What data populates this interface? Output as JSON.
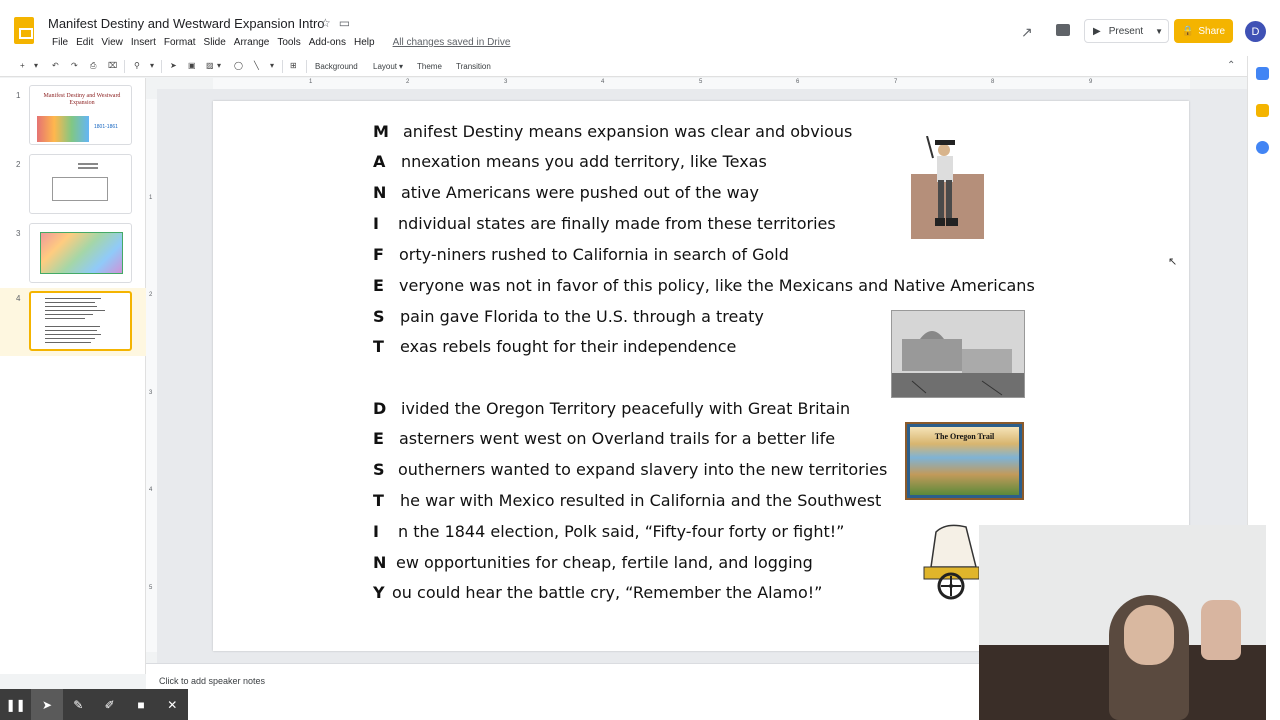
{
  "app": {
    "doc_title": "Manifest Destiny and Westward Expansion Intro",
    "menu": [
      "File",
      "Edit",
      "View",
      "Insert",
      "Format",
      "Slide",
      "Arrange",
      "Tools",
      "Add-ons",
      "Help"
    ],
    "save_status": "All changes saved in Drive",
    "present_label": "Present",
    "share_label": "Share",
    "avatar_letter": "D",
    "accent": "#f4b400"
  },
  "toolbar": {
    "background_label": "Background",
    "layout_label": "Layout",
    "theme_label": "Theme",
    "transition_label": "Transition"
  },
  "ruler": {
    "h_numbers": [
      "1",
      "2",
      "3",
      "4",
      "5",
      "6",
      "7",
      "8",
      "9"
    ],
    "v_numbers": [
      "1",
      "2",
      "3",
      "4",
      "5"
    ]
  },
  "thumbnails": [
    {
      "num": "1",
      "title": "Manifest Destiny and Westward Expansion",
      "year": "1801-1861"
    },
    {
      "num": "2"
    },
    {
      "num": "3"
    },
    {
      "num": "4"
    }
  ],
  "slide": {
    "lines": [
      {
        "letter": "M",
        "rest": "anifest Destiny means expansion was clear and obvious"
      },
      {
        "letter": "A",
        "rest": "nnexation means you add territory, like Texas"
      },
      {
        "letter": "N",
        "rest": "ative Americans were pushed out of the way"
      },
      {
        "letter": "I",
        "rest": "ndividual states are finally made from these territories"
      },
      {
        "letter": "F",
        "rest": "orty-niners rushed to California in search of Gold"
      },
      {
        "letter": "E",
        "rest": "veryone was not in favor of this policy, like the Mexicans and Native Americans"
      },
      {
        "letter": "S",
        "rest": "pain gave Florida to the U.S. through a treaty"
      },
      {
        "letter": "T",
        "rest": "exas rebels fought for their independence"
      },
      {
        "letter": "D",
        "rest": "ivided the Oregon Territory peacefully with Great Britain"
      },
      {
        "letter": "E",
        "rest": "asterners went west on Overland trails for a better life"
      },
      {
        "letter": "S",
        "rest": "outherners wanted to expand slavery into the new territories"
      },
      {
        "letter": "T",
        "rest": "he war with Mexico resulted in California and the Southwest"
      },
      {
        "letter": "I",
        "rest": "n the 1844 election, Polk said, “Fifty-four forty or fight!”"
      },
      {
        "letter": "N",
        "rest": "ew opportunities for cheap, fertile land,  and logging"
      },
      {
        "letter": "Y",
        "rest": "ou could hear the battle cry, “Remember the Alamo!”"
      }
    ],
    "oregon_image_title": "The Oregon Trail"
  },
  "notes_placeholder": "Click to add speaker notes"
}
